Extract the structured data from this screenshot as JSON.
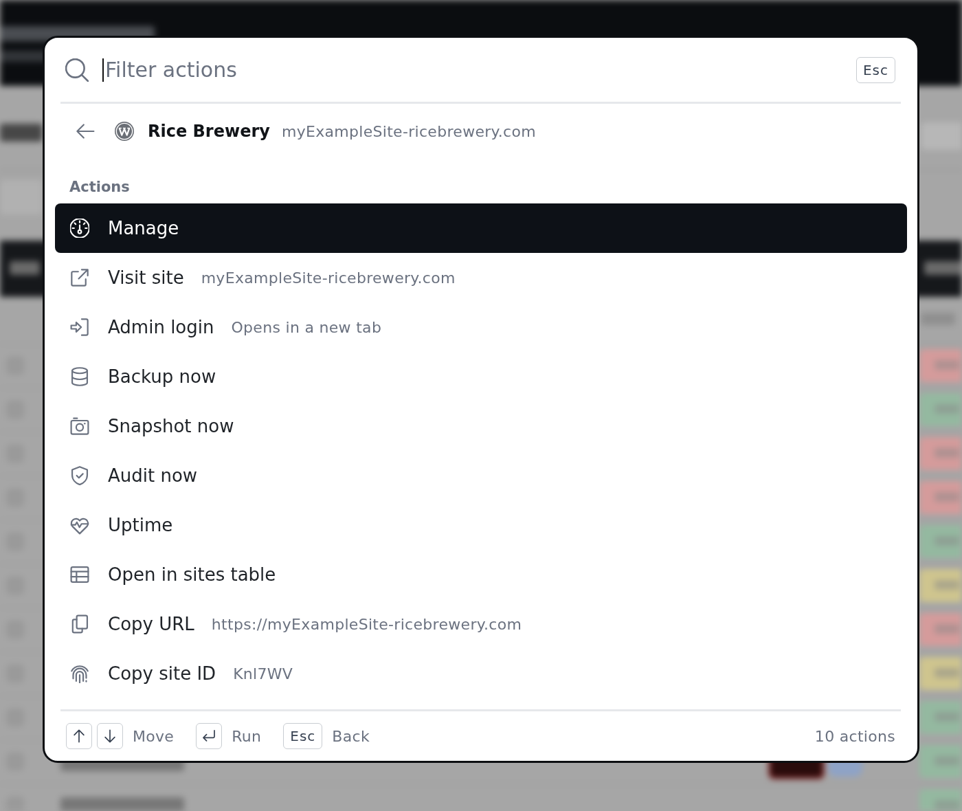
{
  "search": {
    "placeholder": "Filter actions",
    "focused": true,
    "shortcut": "Esc"
  },
  "site": {
    "name": "Rice Brewery",
    "domain": "myExampleSite-ricebrewery.com"
  },
  "section_title": "Actions",
  "actions": [
    {
      "label": "Manage",
      "selected": true
    },
    {
      "label": "Visit site",
      "detail": "myExampleSite-ricebrewery.com",
      "selected": false
    },
    {
      "label": "Admin login",
      "detail": "Opens in a new tab",
      "selected": false
    },
    {
      "label": "Backup now",
      "selected": false
    },
    {
      "label": "Snapshot now",
      "selected": false
    },
    {
      "label": "Audit now",
      "selected": false
    },
    {
      "label": "Uptime",
      "selected": false
    },
    {
      "label": "Open in sites table",
      "selected": false
    },
    {
      "label": "Copy URL",
      "detail": "https://myExampleSite-ricebrewery.com",
      "selected": false
    },
    {
      "label": "Copy site ID",
      "detail": "Knl7WV",
      "selected": false
    }
  ],
  "footer": {
    "hints": [
      {
        "keys": [
          {
            "kind": "icon"
          },
          {
            "kind": "icon"
          }
        ],
        "label": "Move"
      },
      {
        "keys": [
          {
            "kind": "icon"
          }
        ],
        "label": "Run"
      },
      {
        "keys": [
          {
            "kind": "text",
            "text": "Esc"
          }
        ],
        "label": "Back"
      }
    ],
    "count": "10 actions"
  }
}
